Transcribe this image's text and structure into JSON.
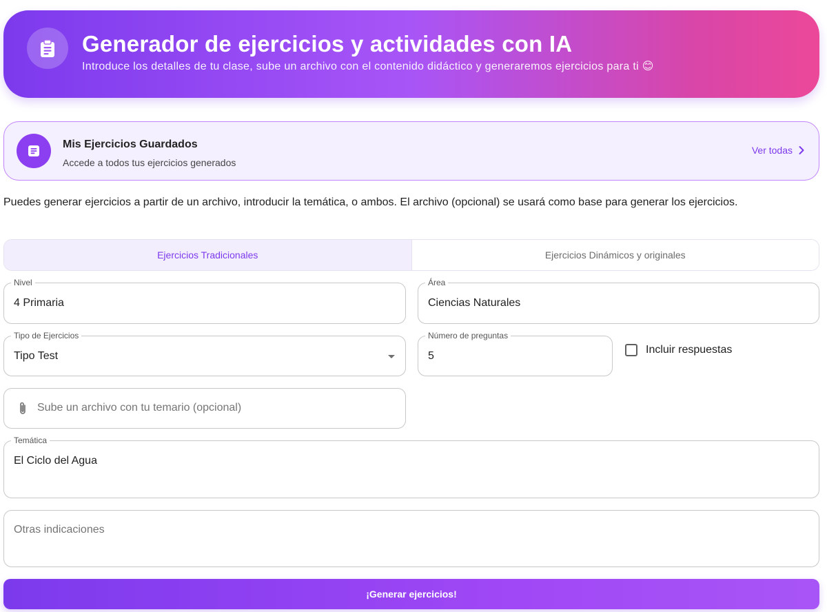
{
  "header": {
    "icon": "clipboard-icon",
    "title": "Generador de ejercicios y actividades con IA",
    "subtitle": "Introduce los detalles de tu clase, sube un archivo con el contenido didáctico y generaremos ejercicios para ti 😊"
  },
  "saved": {
    "icon": "document-icon",
    "title": "Mis Ejercicios Guardados",
    "subtitle": "Accede a todos tus ejercicios generados",
    "link_label": "Ver todas",
    "link_icon": "chevron-right-icon"
  },
  "intro": "Puedes generar ejercicios a partir de un archivo, introducir la temática, o ambos. El archivo (opcional) se usará como base para generar los ejercicios.",
  "tabs": [
    {
      "label": "Ejercicios Tradicionales",
      "active": true
    },
    {
      "label": "Ejercicios Dinámicos y originales",
      "active": false
    }
  ],
  "form": {
    "nivel": {
      "label": "Nivel",
      "value": "4 Primaria"
    },
    "area": {
      "label": "Área",
      "value": "Ciencias Naturales"
    },
    "tipo": {
      "label": "Tipo de Ejercicios",
      "value": "Tipo Test"
    },
    "preguntas": {
      "label": "Número de preguntas",
      "value": "5"
    },
    "incluir_respuestas": {
      "label": "Incluir respuestas",
      "checked": false
    },
    "archivo": {
      "placeholder": "Sube un archivo con tu temario (opcional)",
      "icon": "paperclip-icon"
    },
    "tematica": {
      "label": "Temática",
      "value": "El Ciclo del Agua"
    },
    "otras": {
      "placeholder": "Otras indicaciones"
    }
  },
  "submit_label": "¡Generar ejercicios!",
  "colors": {
    "accent": "#7c3aed",
    "accent_light": "#f3eefe",
    "gradient_end": "#ec4899"
  }
}
